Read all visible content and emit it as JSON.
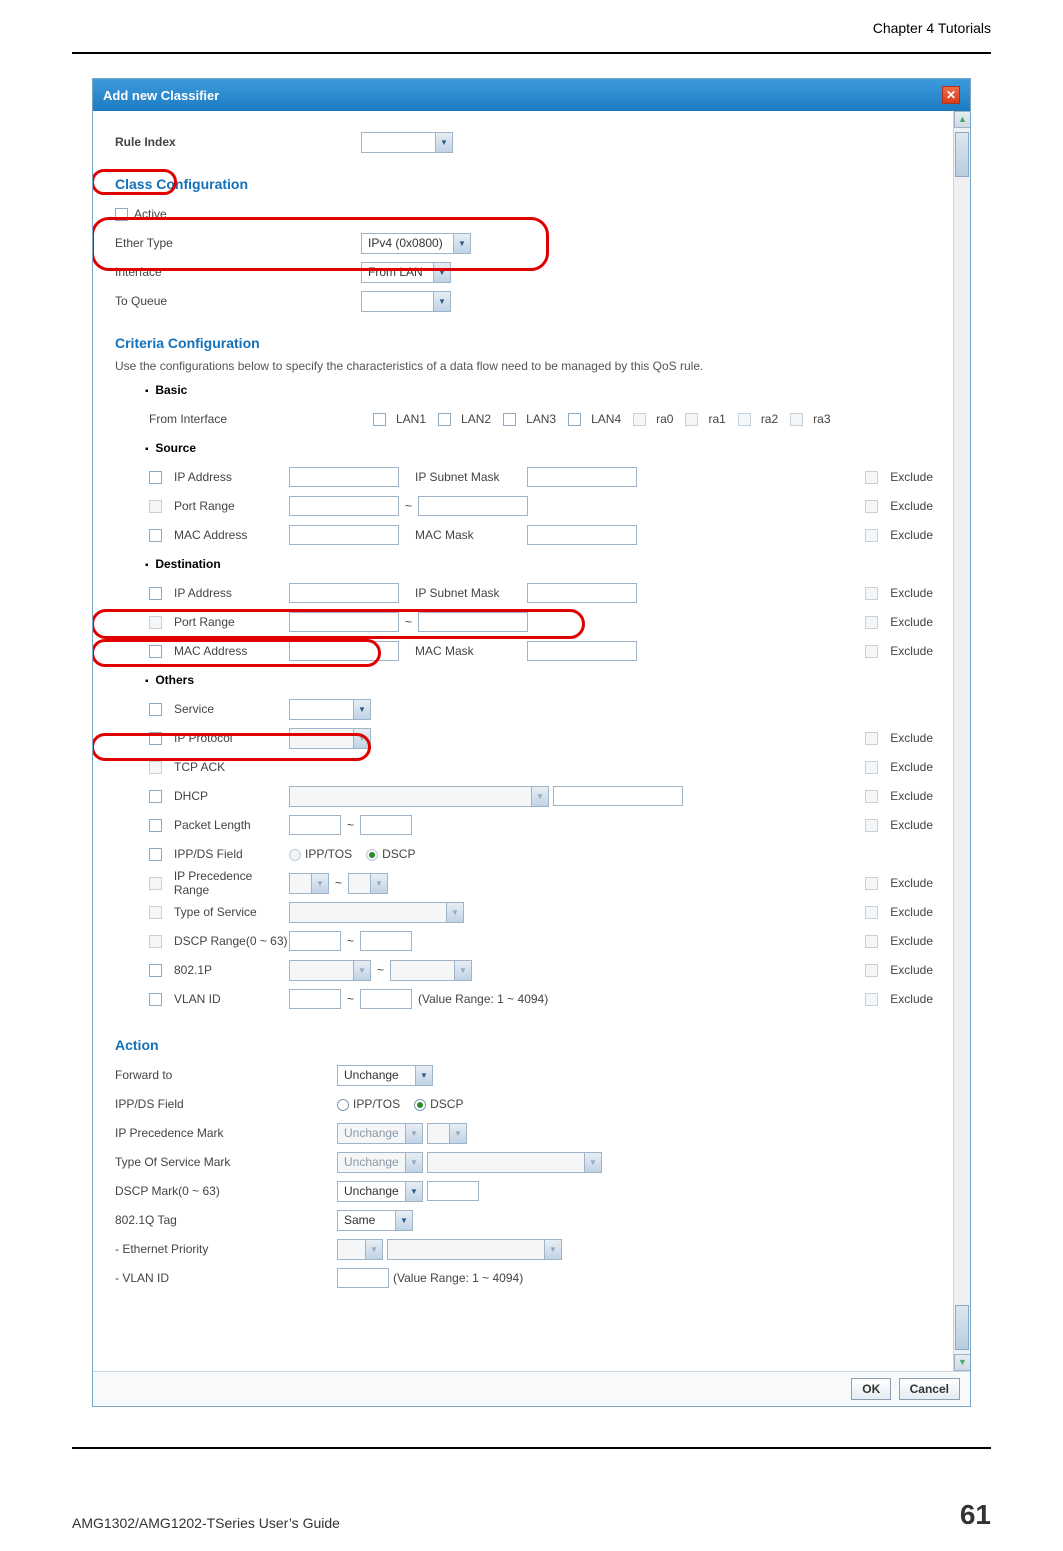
{
  "page_header": "Chapter 4 Tutorials",
  "dialog_title": "Add new Classifier",
  "rule_index_label": "Rule Index",
  "class_config_title": "Class Configuration",
  "class": {
    "active_label": "Active",
    "ether_type_label": "Ether Type",
    "ether_type_value": "IPv4 (0x0800)",
    "interface_label": "Interface",
    "interface_value": "From LAN",
    "to_queue_label": "To Queue"
  },
  "criteria_title": "Criteria Configuration",
  "criteria_desc": "Use the configurations below to specify the characteristics of a data flow need to be managed by this QoS rule.",
  "basic_title": "Basic",
  "from_interface_label": "From Interface",
  "interfaces": [
    "LAN1",
    "LAN2",
    "LAN3",
    "LAN4",
    "ra0",
    "ra1",
    "ra2",
    "ra3"
  ],
  "source_title": "Source",
  "dest_title": "Destination",
  "others_title": "Others",
  "labels": {
    "ip_address": "IP Address",
    "ip_subnet_mask": "IP Subnet Mask",
    "port_range": "Port Range",
    "mac_address": "MAC Address",
    "mac_mask": "MAC Mask",
    "exclude": "Exclude",
    "service": "Service",
    "ip_protocol": "IP Protocol",
    "tcp_ack": "TCP ACK",
    "dhcp": "DHCP",
    "packet_length": "Packet Length",
    "ipp_ds_field": "IPP/DS Field",
    "ipp_tos": "IPP/TOS",
    "dscp": "DSCP",
    "ip_precedence_range": "IP Precedence Range",
    "type_of_service": "Type of Service",
    "dscp_range": "DSCP Range(0 ~ 63)",
    "8021p": "802.1P",
    "vlan_id": "VLAN ID",
    "vlan_range": "(Value Range: 1 ~ 4094)"
  },
  "action_title": "Action",
  "action": {
    "forward_to_label": "Forward to",
    "forward_to_value": "Unchange",
    "ipp_ds_field_label": "IPP/DS Field",
    "ipp_tos": "IPP/TOS",
    "dscp": "DSCP",
    "ip_precedence_mark_label": "IP Precedence Mark",
    "ip_precedence_mark_value": "Unchange",
    "tos_mark_label": "Type Of Service Mark",
    "tos_mark_value": "Unchange",
    "dscp_mark_label": "DSCP Mark(0 ~ 63)",
    "dscp_mark_value": "Unchange",
    "tag_label": "802.1Q Tag",
    "tag_value": "Same",
    "eth_priority_label": "- Ethernet Priority",
    "vlan_id_label": "- VLAN ID",
    "vlan_range": "(Value Range: 1 ~ 4094)"
  },
  "buttons": {
    "ok": "OK",
    "cancel": "Cancel"
  },
  "footer_left": "AMG1302/AMG1202-TSeries User’s Guide",
  "footer_right": "61"
}
